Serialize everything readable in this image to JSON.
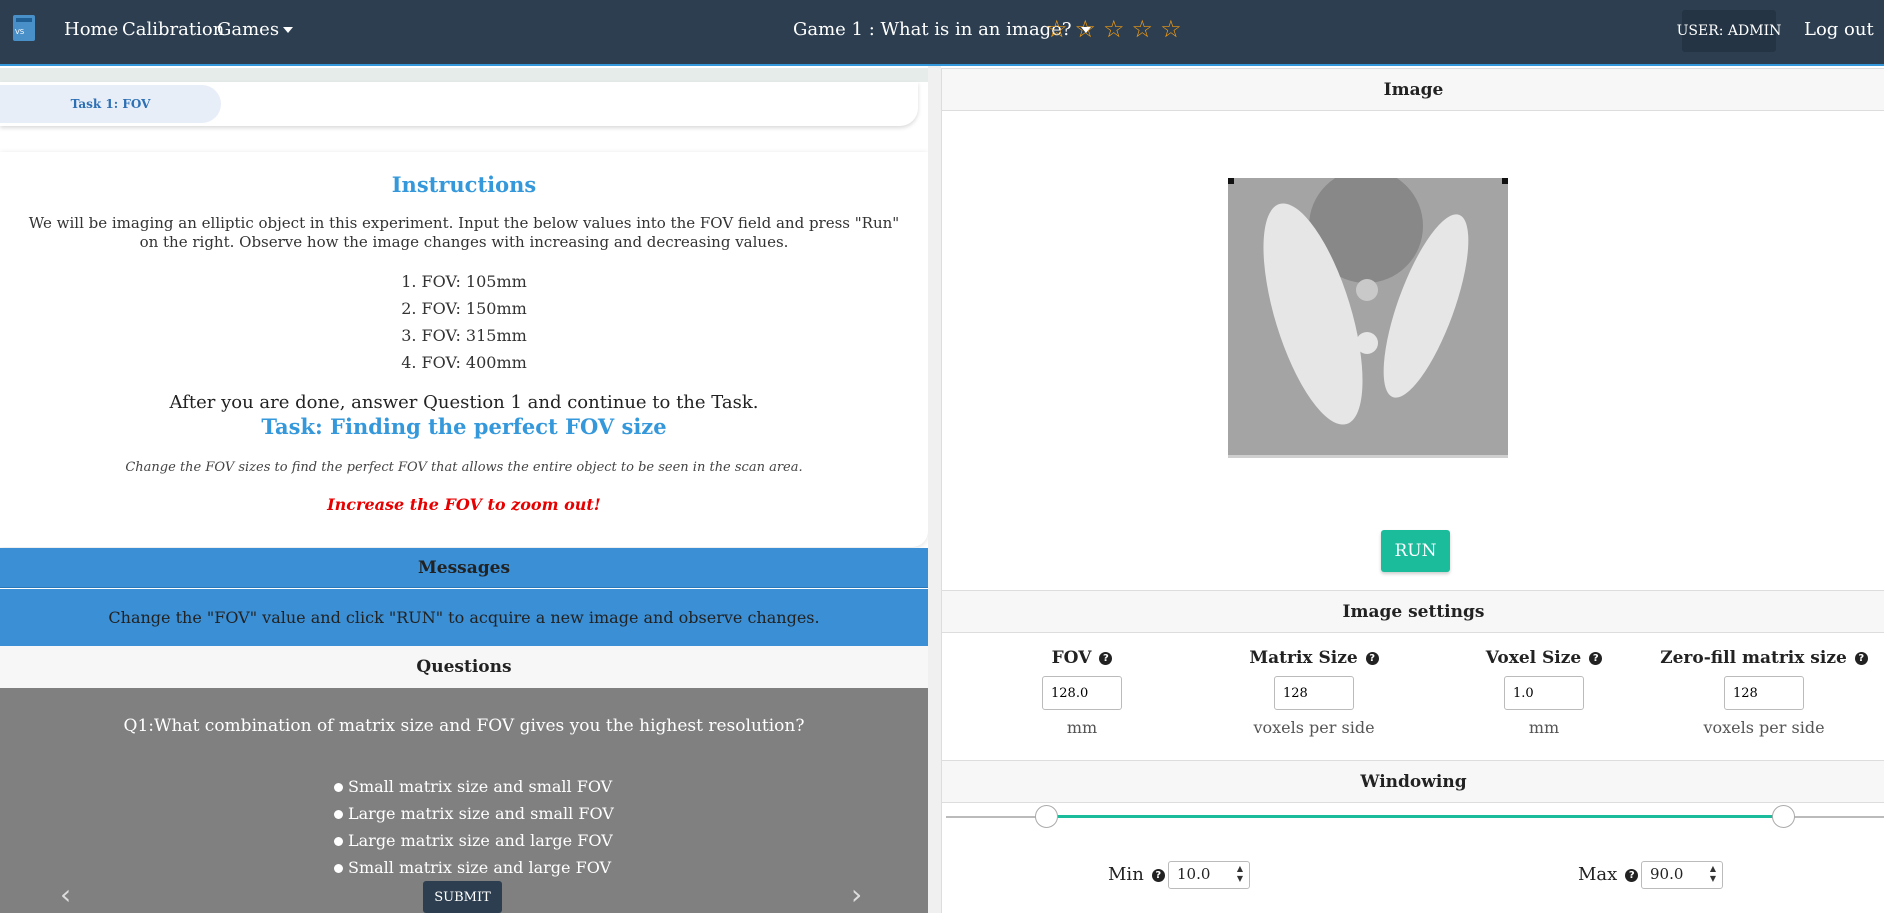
{
  "nav": {
    "links": {
      "home": "Home",
      "calibration": "Calibration",
      "games": "Games"
    },
    "game_title": "Game 1 : What is in an image?",
    "stars": [
      "☆",
      "☆",
      "☆",
      "☆",
      "☆"
    ],
    "user": "USER: ADMIN",
    "logout": "Log out",
    "logo_text": "VS"
  },
  "tab": {
    "label": "Task 1: FOV"
  },
  "instructions": {
    "title": "Instructions",
    "text": "We will be imaging an elliptic object in this experiment. Input the below values into the FOV field and press \"Run\" on the right. Observe how the image changes with increasing and decreasing values.",
    "fov_values": [
      "1. FOV: 105mm",
      "2. FOV: 150mm",
      "3. FOV: 315mm",
      "4. FOV: 400mm"
    ],
    "after": "After you are done, answer Question 1 and continue to the Task.",
    "task_title": "Task: Finding the perfect FOV size",
    "task_text": "Change the FOV sizes to find the perfect FOV that allows the entire object to be seen in the scan area.",
    "zoom_hint": "Increase the FOV to zoom out!"
  },
  "messages": {
    "title": "Messages",
    "text": "Change the \"FOV\" value and click \"RUN\" to acquire a new image and observe changes."
  },
  "questions": {
    "title": "Questions",
    "q1": "Q1:What combination of matrix size and FOV gives you the highest resolution?",
    "options": [
      "Small matrix size and small FOV",
      "Large matrix size and small FOV",
      "Large matrix size and large FOV",
      "Small matrix size and large FOV"
    ],
    "submit": "SUBMIT",
    "prev": "‹",
    "next": "›"
  },
  "image_panel": {
    "title": "Image",
    "run": "RUN"
  },
  "settings": {
    "title": "Image settings",
    "fov": {
      "label": "FOV",
      "value": "128.0",
      "unit": "mm"
    },
    "matrix": {
      "label": "Matrix Size",
      "value": "128",
      "unit": "voxels per side"
    },
    "voxel": {
      "label": "Voxel Size",
      "value": "1.0",
      "unit": "mm"
    },
    "zerofill": {
      "label": "Zero-fill matrix size",
      "value": "128",
      "unit": "voxels per side"
    },
    "help": "?"
  },
  "windowing": {
    "title": "Windowing",
    "min_label": "Min",
    "min_value": "10.0",
    "max_label": "Max",
    "max_value": "90.0"
  }
}
